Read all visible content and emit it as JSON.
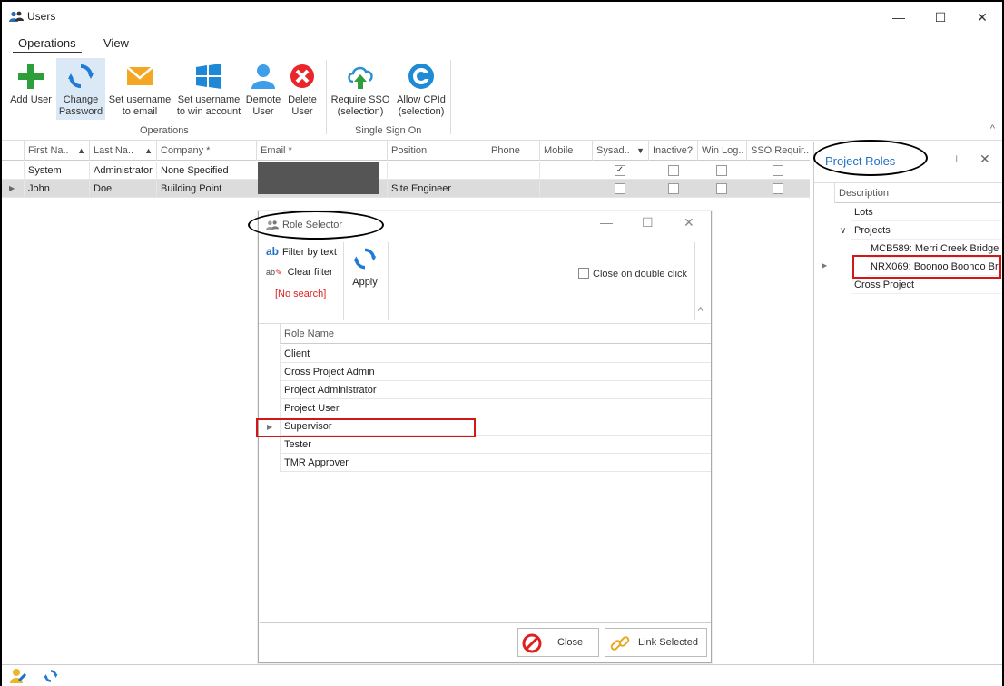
{
  "window": {
    "title": "Users",
    "minimize": "—",
    "maximize": "☐",
    "close": "✕"
  },
  "ribbon": {
    "tabs": [
      {
        "label": "Operations"
      },
      {
        "label": "View"
      }
    ],
    "buttons": {
      "add_user": "Add User",
      "change_password_1": "Change",
      "change_password_2": "Password",
      "set_email_1": "Set username",
      "set_email_2": "to email",
      "set_win_1": "Set username",
      "set_win_2": "to win account",
      "demote_1": "Demote",
      "demote_2": "User",
      "delete_1": "Delete",
      "delete_2": "User",
      "require_sso_1": "Require SSO",
      "require_sso_2": "(selection)",
      "allow_cpid_1": "Allow CPId",
      "allow_cpid_2": "(selection)"
    },
    "groups": {
      "operations": "Operations",
      "sso": "Single Sign On"
    },
    "collapse": "^"
  },
  "grid": {
    "columns": {
      "first": "First Na..",
      "last": "Last Na..",
      "company": "Company *",
      "email": "Email *",
      "position": "Position",
      "phone": "Phone",
      "mobile": "Mobile",
      "sysad": "Sysad..",
      "inactive": "Inactive?",
      "winlog": "Win Log..",
      "sso": "SSO Requir..."
    },
    "rows": [
      {
        "first": "System",
        "last": "Administrator",
        "company": "None Specified",
        "position": "",
        "sysad": "✓"
      },
      {
        "first": "John",
        "last": "Doe",
        "company": "Building Point",
        "position": "Site Engineer",
        "sysad": ""
      }
    ]
  },
  "roles_panel": {
    "title": "Project Roles",
    "pin": "⊥",
    "close": "✕",
    "header": "Description",
    "nodes": {
      "lots": "Lots",
      "projects": "Projects",
      "mcb": "MCB589: Merri Creek Bridge",
      "nrx": "NRX069: Boonoo Boonoo Br...",
      "cross": "Cross Project"
    }
  },
  "dialog": {
    "title": "Role Selector",
    "filter_by_text": "Filter by text",
    "clear_filter": "Clear filter",
    "no_search": "[No search]",
    "apply": "Apply",
    "close_on_double_click": "Close on double click",
    "role_header": "Role Name",
    "roles": [
      "Client",
      "Cross Project Admin",
      "Project Administrator",
      "Project User",
      "Supervisor",
      "Tester",
      "TMR Approver"
    ],
    "close_button": "Close",
    "link_button": "Link Selected",
    "collapse": "^"
  },
  "colors": {
    "accent": "#1f6fc4",
    "highlight": "#d01818",
    "selected_row": "#dcdcdc"
  }
}
